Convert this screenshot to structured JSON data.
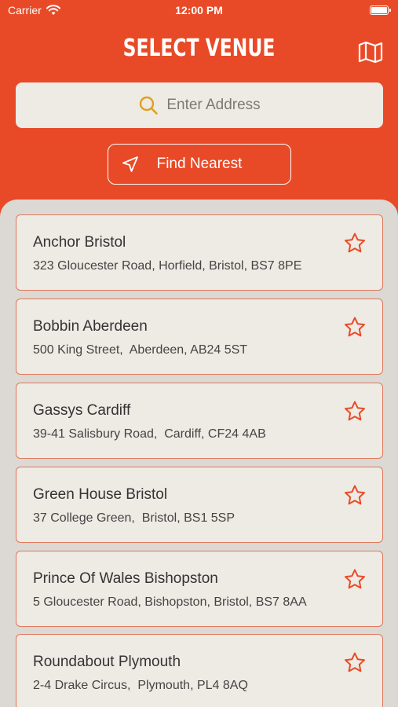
{
  "status_bar": {
    "carrier": "Carrier",
    "time": "12:00 PM"
  },
  "header": {
    "title": "SELECT VENUE",
    "map_icon": "map-icon"
  },
  "search": {
    "placeholder": "Enter Address"
  },
  "find_nearest": {
    "label": "Find Nearest"
  },
  "colors": {
    "brand": "#E84A27",
    "panel": "#DCD8D3",
    "card": "#EEEAE4",
    "accent_icon": "#E0A020"
  },
  "venues": [
    {
      "name": "Anchor Bristol",
      "address": "323 Gloucester Road, Horfield, Bristol, BS7 8PE"
    },
    {
      "name": "Bobbin Aberdeen",
      "address": "500 King Street,  Aberdeen, AB24 5ST"
    },
    {
      "name": "Gassys Cardiff",
      "address": "39-41 Salisbury Road,  Cardiff, CF24 4AB"
    },
    {
      "name": "Green House Bristol",
      "address": "37 College Green,  Bristol, BS1 5SP"
    },
    {
      "name": "Prince Of Wales Bishopston",
      "address": "5 Gloucester Road, Bishopston, Bristol, BS7 8AA"
    },
    {
      "name": "Roundabout Plymouth",
      "address": "2-4 Drake Circus,  Plymouth, PL4 8AQ"
    }
  ]
}
